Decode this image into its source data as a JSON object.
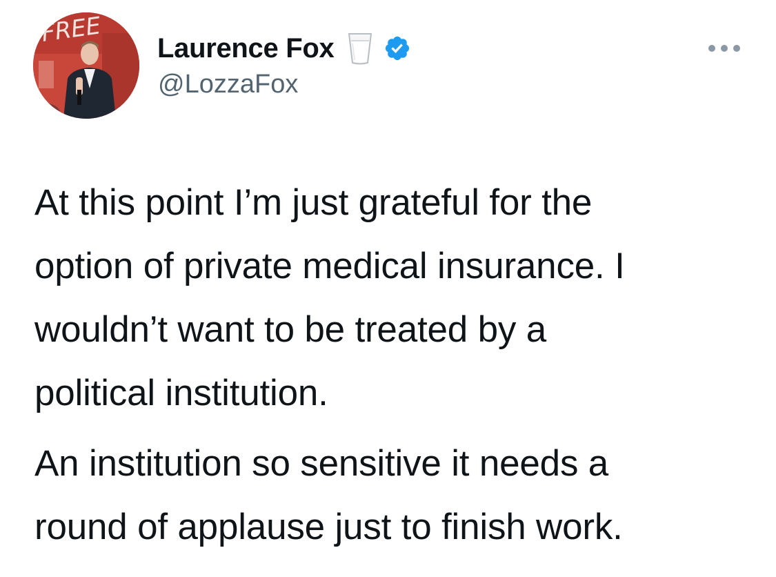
{
  "tweet": {
    "author": {
      "display_name": "Laurence Fox",
      "handle": "@LozzaFox",
      "emoji_icon": "milk-glass-icon",
      "verified_icon": "verified-badge-icon",
      "avatar_sign_text": "FREE"
    },
    "menu": {
      "icon": "more-options-icon"
    },
    "paragraphs": [
      {
        "lines": [
          "At this point I’m just grateful for the",
          "option of private medical insurance. I",
          "wouldn’t want to be treated by a",
          "political institution."
        ]
      },
      {
        "lines": [
          "An institution so sensitive it needs a",
          "round of applause just to finish work."
        ]
      }
    ]
  },
  "colors": {
    "text": "#0f1419",
    "secondary": "#536471",
    "verified": "#1d9bf0",
    "avatar_background": "#c8443a"
  }
}
